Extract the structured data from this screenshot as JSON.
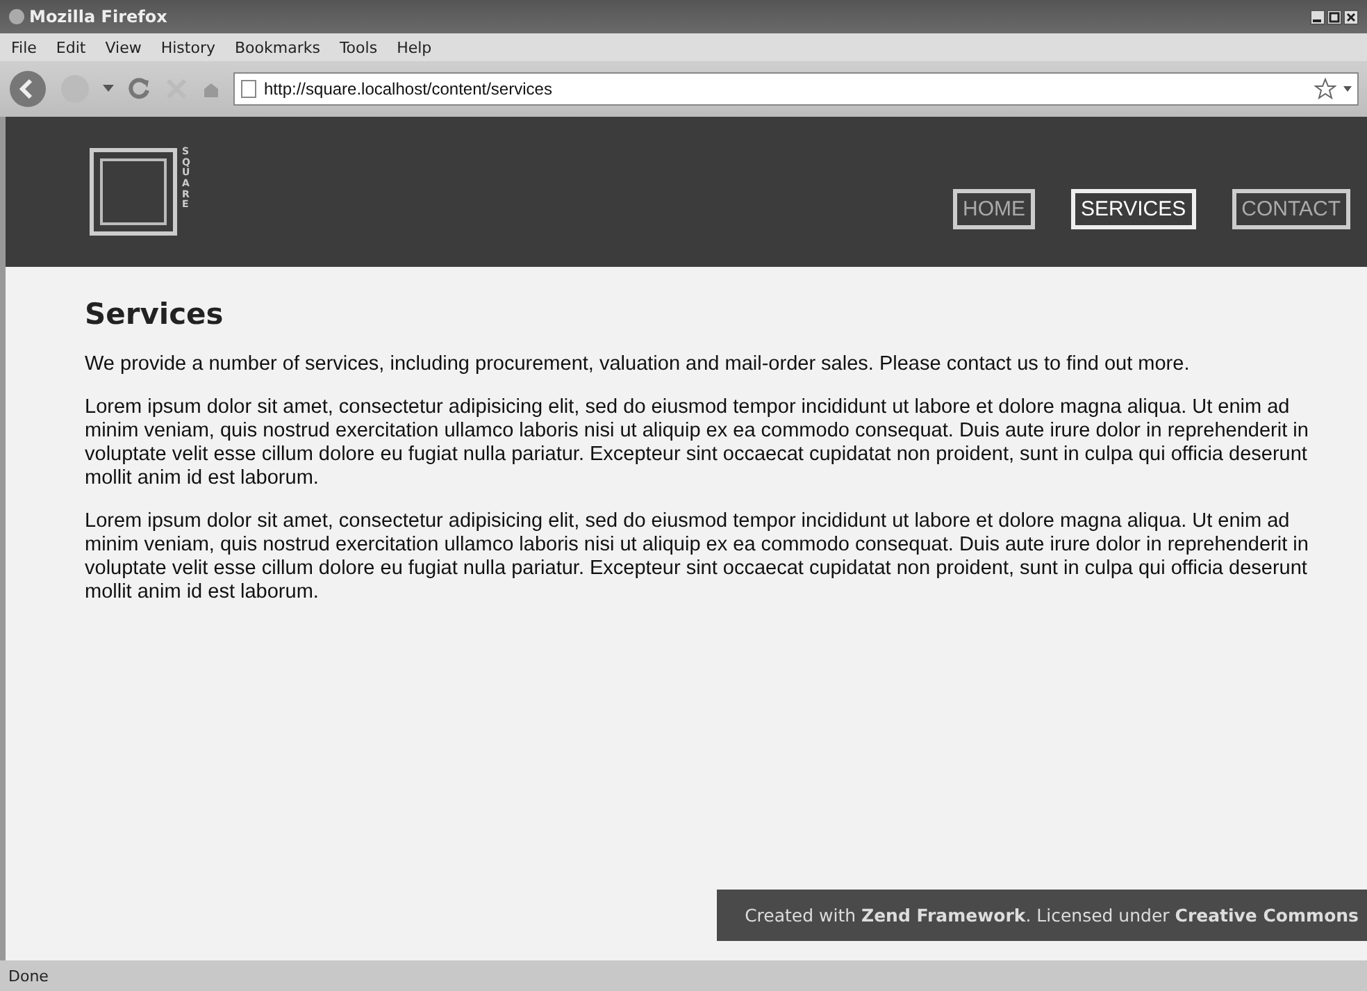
{
  "window": {
    "title": "Mozilla Firefox"
  },
  "menu": [
    "File",
    "Edit",
    "View",
    "History",
    "Bookmarks",
    "Tools",
    "Help"
  ],
  "address_bar": {
    "value": "http://square.localhost/content/services"
  },
  "site": {
    "logo_text": "SQUARE",
    "nav": [
      {
        "label": "HOME",
        "selected": false
      },
      {
        "label": "SERVICES",
        "selected": true
      },
      {
        "label": "CONTACT",
        "selected": false
      }
    ]
  },
  "content": {
    "heading": "Services",
    "paragraphs": [
      "We provide a number of services, including procurement, valuation and mail-order sales. Please contact us to find out more.",
      "Lorem ipsum dolor sit amet, consectetur adipisicing elit, sed do eiusmod tempor incididunt ut labore et dolore magna aliqua. Ut enim ad minim veniam, quis nostrud exercitation ullamco laboris nisi ut aliquip ex ea commodo consequat. Duis aute irure dolor in reprehenderit in voluptate velit esse cillum dolore eu fugiat nulla pariatur. Excepteur sint occaecat cupidatat non proident, sunt in culpa qui officia deserunt mollit anim id est laborum.",
      "Lorem ipsum dolor sit amet, consectetur adipisicing elit, sed do eiusmod tempor incididunt ut labore et dolore magna aliqua. Ut enim ad minim veniam, quis nostrud exercitation ullamco laboris nisi ut aliquip ex ea commodo consequat. Duis aute irure dolor in reprehenderit in voluptate velit esse cillum dolore eu fugiat nulla pariatur. Excepteur sint occaecat cupidatat non proident, sunt in culpa qui officia deserunt mollit anim id est laborum."
    ]
  },
  "footer": "Created with **Zend Framework**. Licensed under **Creative Commons**",
  "status_bar": "Done"
}
